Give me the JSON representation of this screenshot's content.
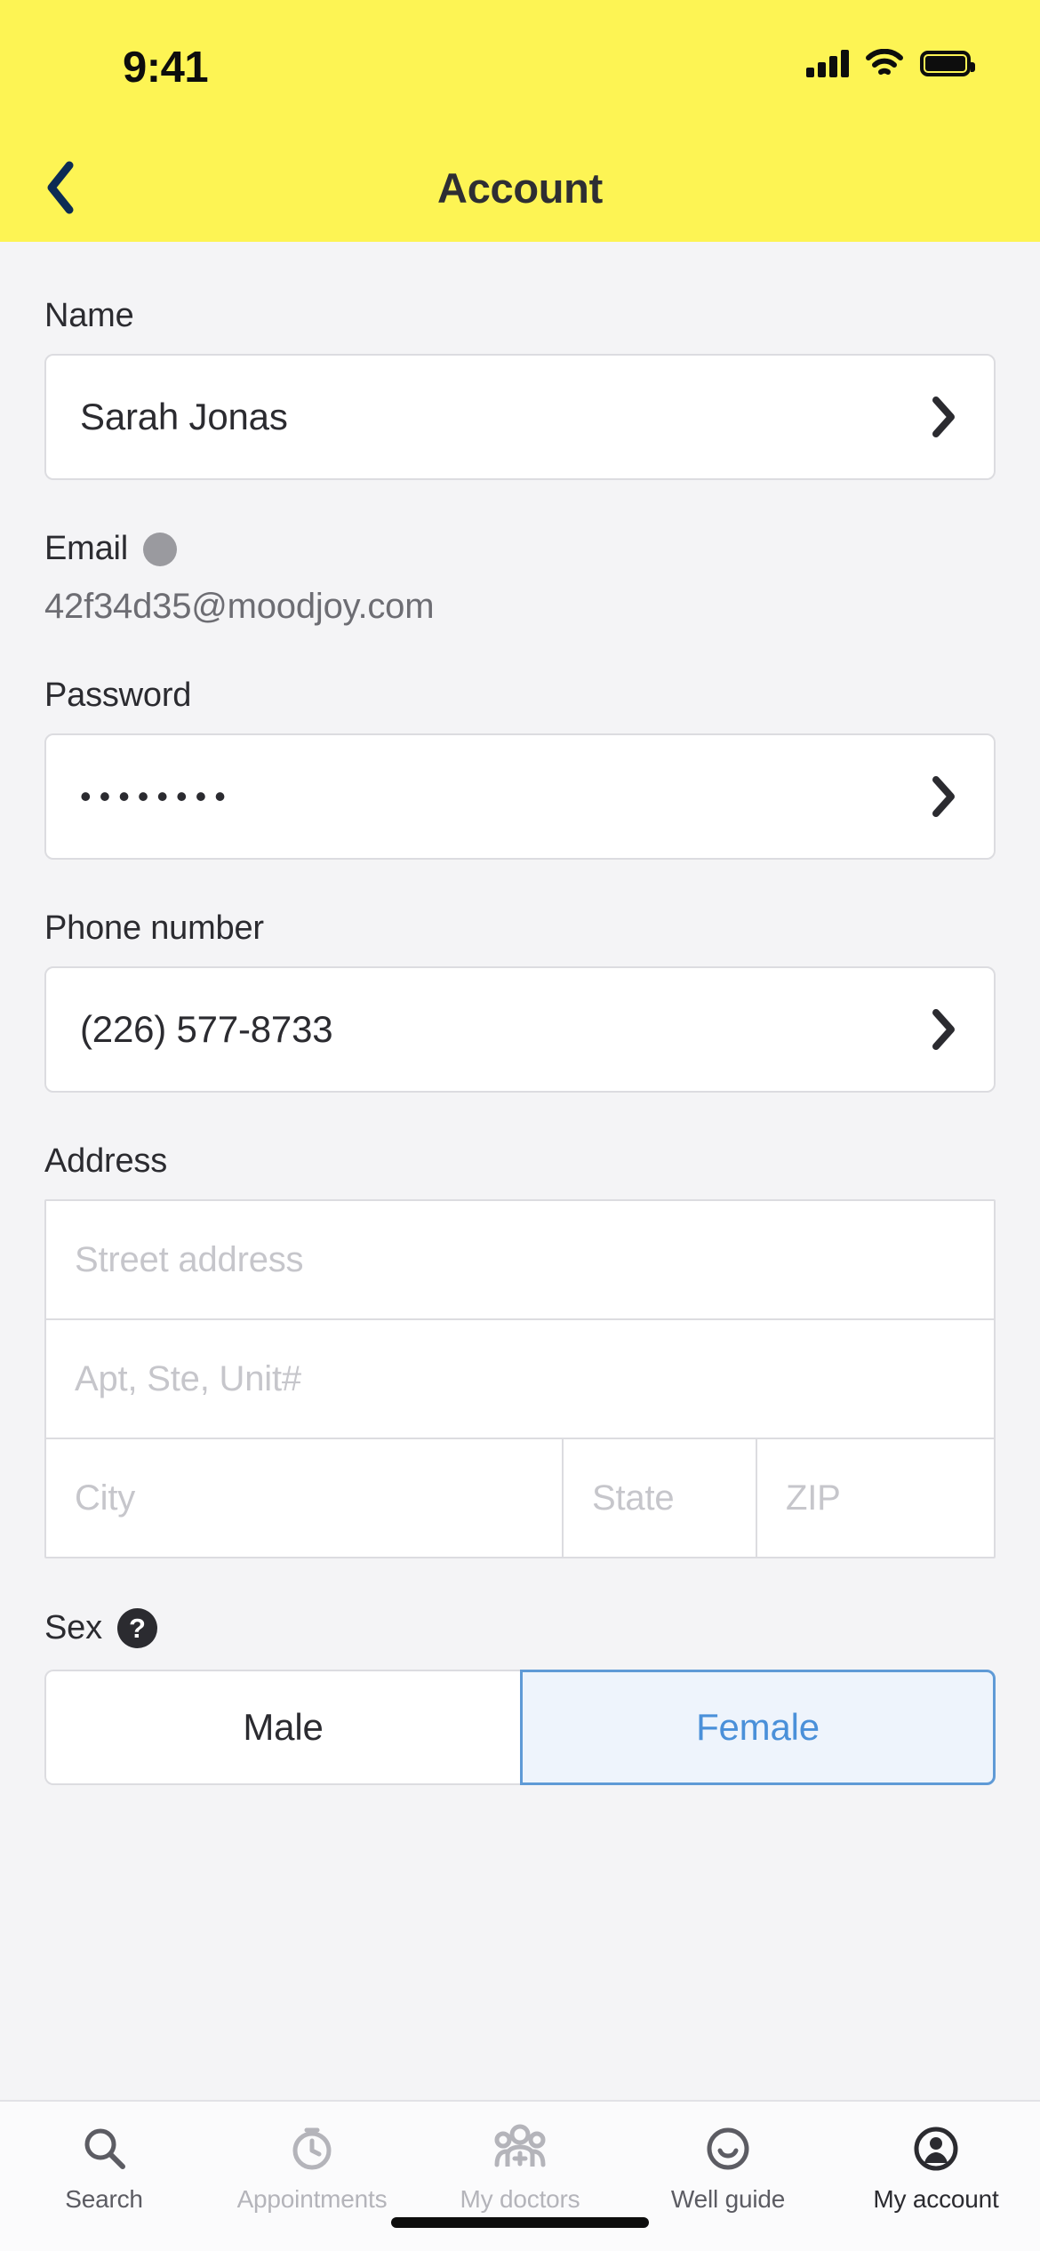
{
  "status_bar": {
    "time": "9:41",
    "signal_icon": "cellular-signal-icon",
    "wifi_icon": "wifi-icon",
    "battery_icon": "battery-full-icon"
  },
  "header": {
    "title": "Account",
    "back_icon": "chevron-left-icon",
    "background_color": "#fdf454",
    "back_icon_color": "#0d2c54"
  },
  "form": {
    "name": {
      "label": "Name",
      "value": "Sarah Jonas",
      "chevron_icon": "chevron-right-icon"
    },
    "email": {
      "label": "Email",
      "badge_icon": "gray-dot-icon",
      "value": "42f34d35@moodjoy.com"
    },
    "password": {
      "label": "Password",
      "value": "••••••••",
      "chevron_icon": "chevron-right-icon"
    },
    "phone": {
      "label": "Phone number",
      "value": "(226) 577-8733",
      "chevron_icon": "chevron-right-icon"
    },
    "address": {
      "label": "Address",
      "street_placeholder": "Street address",
      "street_value": "",
      "unit_placeholder": "Apt, Ste, Unit#",
      "unit_value": "",
      "city_placeholder": "City",
      "city_value": "",
      "state_placeholder": "State",
      "state_value": "",
      "zip_placeholder": "ZIP",
      "zip_value": ""
    },
    "sex": {
      "label": "Sex",
      "help_icon": "question-mark-icon",
      "help_glyph": "?",
      "options": [
        {
          "label": "Male",
          "selected": false
        },
        {
          "label": "Female",
          "selected": true
        }
      ],
      "selected_color": "#4a90d9",
      "selected_border_color": "#5f9ad6",
      "selected_fill_color": "#eef4fc"
    }
  },
  "tabbar": {
    "items": [
      {
        "label": "Search",
        "icon": "search-icon",
        "state": "semi"
      },
      {
        "label": "Appointments",
        "icon": "clock-icon",
        "state": "dim"
      },
      {
        "label": "My doctors",
        "icon": "people-medical-icon",
        "state": "dim"
      },
      {
        "label": "Well guide",
        "icon": "smiley-icon",
        "state": "semi"
      },
      {
        "label": "My account",
        "icon": "account-circle-icon",
        "state": "active"
      }
    ]
  }
}
